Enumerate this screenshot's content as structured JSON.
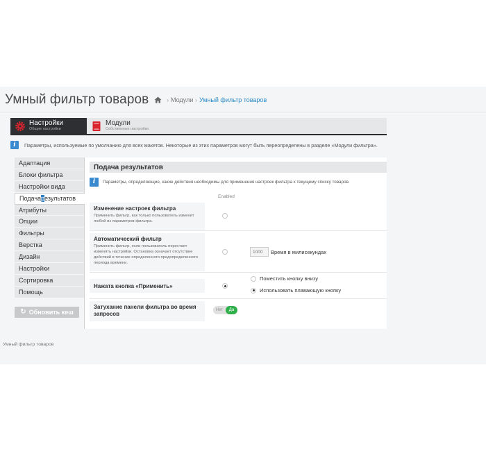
{
  "header": {
    "title": "Умный фильтр товаров",
    "breadcrumb": [
      "Модули",
      "Умный фильтр товаров"
    ]
  },
  "tabs": [
    {
      "label": "Настройки",
      "sublabel": "Общие настройки",
      "icon": "gear-icon",
      "active": true
    },
    {
      "label": "Модули",
      "sublabel": "Собственные настройки",
      "icon": "module-icon",
      "active": false
    }
  ],
  "info_text": "Параметры, используемые по умолчанию для всех макетов. Некоторые из этих параметров могут быть переопределены в разделе «Модули фильтра».",
  "sidebar": {
    "items": [
      {
        "label": "Адаптация"
      },
      {
        "label": "Блоки фильтра"
      },
      {
        "label": "Настройки вида"
      },
      {
        "label_before": "Подача ",
        "label_sel": "р",
        "label_after": "езультатов",
        "active": true
      },
      {
        "label": "Атрибуты"
      },
      {
        "label": "Опции"
      },
      {
        "label": "Фильтры"
      },
      {
        "label": "Верстка"
      },
      {
        "label": "Дизайн"
      },
      {
        "label": "Настройки"
      },
      {
        "label": "Сортировка"
      },
      {
        "label": "Помощь"
      }
    ],
    "refresh_button": "Обновить кеш"
  },
  "panel": {
    "title": "Подача результатов",
    "info": "Параметры, определяющие, какие действия необходимы для применения настроек фильтра к текущему списку товаров.",
    "column_header": "Enabled",
    "rows": [
      {
        "title": "Изменение настроек фильтра",
        "desc": "Применить фильтр, как только пользователь изменит любой из параметров фильтра.",
        "enabled": false
      },
      {
        "title": "Автоматический фильтр",
        "desc": "Применить фильтр, если пользователь перестает изменять настройки. Остановка означает отсутствие действий в течение определенного предопределенного периода времени.",
        "enabled": false,
        "delay_value": "1000",
        "delay_label": "Время в милисекундах"
      },
      {
        "title": "Нажата кнопка «Применить»",
        "enabled": true,
        "choices": [
          {
            "label": "Поместить кнопку внизу",
            "selected": false
          },
          {
            "label": "Использовать плавающую кнопку",
            "selected": true
          }
        ]
      },
      {
        "title": "Затухание панели фильтра во время запросов",
        "toggle_no": "Нет",
        "toggle_yes": "Да",
        "value": "Да"
      }
    ]
  },
  "footer": "Умный фильтр товаров",
  "colors": {
    "accent": "#2f7fc4",
    "toggle_on": "#2eaf4a",
    "dark_tab": "#2d2f33",
    "gear": "#d9232d"
  }
}
